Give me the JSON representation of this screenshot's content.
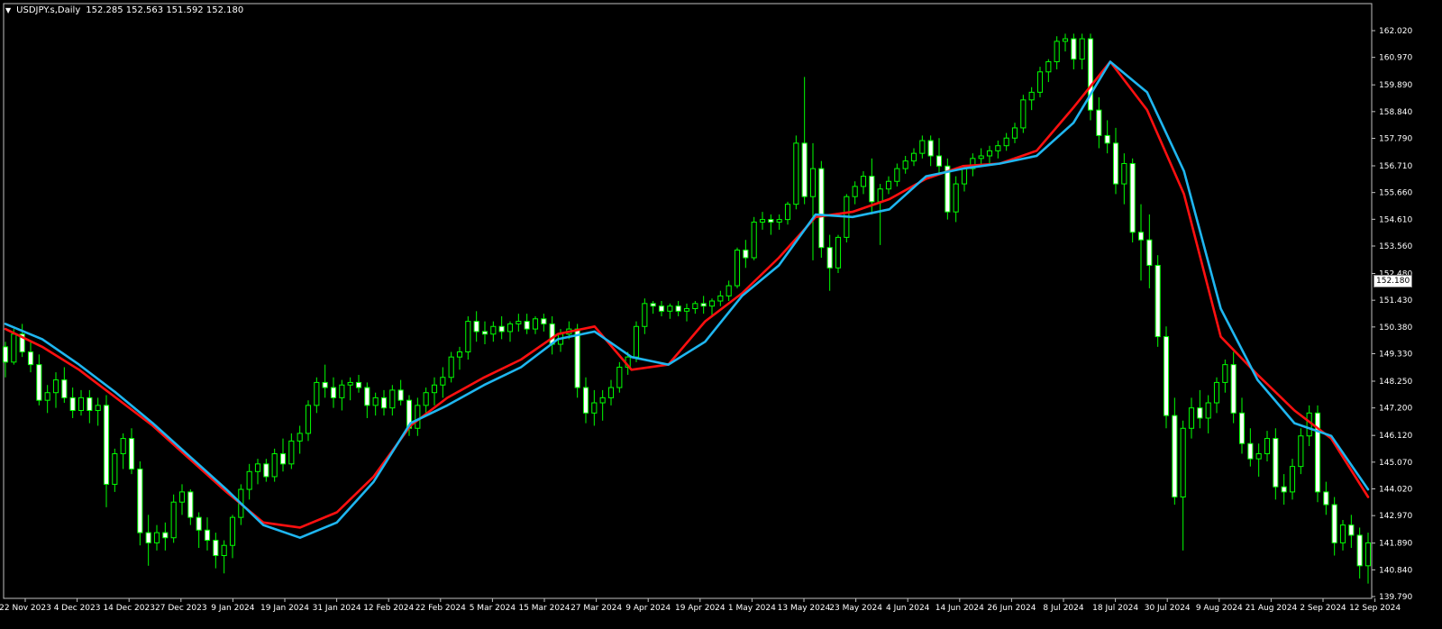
{
  "window": {
    "symbol_label": "USDJPY.s,Daily",
    "ohlc_label": "152.285 152.563 151.592 152.180",
    "current_price": "152.180"
  },
  "chart_data": {
    "type": "candlestick",
    "title": "USDJPY.s,Daily",
    "ylim": [
      139.79,
      162.4
    ],
    "y_ticks": [
      162.02,
      160.97,
      159.89,
      158.84,
      157.79,
      156.71,
      155.66,
      154.61,
      153.56,
      152.48,
      151.43,
      150.38,
      149.33,
      148.25,
      147.2,
      146.12,
      145.07,
      144.02,
      142.97,
      141.89,
      140.84,
      139.79
    ],
    "x_tick_labels": [
      "22 Nov 2023",
      "4 Dec 2023",
      "14 Dec 2023",
      "27 Dec 2023",
      "9 Jan 2024",
      "19 Jan 2024",
      "31 Jan 2024",
      "12 Feb 2024",
      "22 Feb 2024",
      "5 Mar 2024",
      "15 Mar 2024",
      "27 Mar 2024",
      "9 Apr 2024",
      "19 Apr 2024",
      "1 May 2024",
      "13 May 2024",
      "23 May 2024",
      "4 Jun 2024",
      "14 Jun 2024",
      "26 Jun 2024",
      "8 Jul 2024",
      "18 Jul 2024",
      "30 Jul 2024",
      "9 Aug 2024",
      "21 Aug 2024",
      "2 Sep 2024",
      "12 Sep 2024"
    ],
    "series": [
      {
        "name": "",
        "kind": "candles",
        "color": "#00ff00",
        "values": [
          [
            149.6,
            149.8,
            148.4,
            149.0
          ],
          [
            149.0,
            150.3,
            148.9,
            150.1
          ],
          [
            150.1,
            150.5,
            149.2,
            149.4
          ],
          [
            149.4,
            149.8,
            148.6,
            148.9
          ],
          [
            148.9,
            149.3,
            147.3,
            147.5
          ],
          [
            147.5,
            148.1,
            147.0,
            147.8
          ],
          [
            147.8,
            148.6,
            147.2,
            148.3
          ],
          [
            148.3,
            148.8,
            147.4,
            147.6
          ],
          [
            147.6,
            148.0,
            146.8,
            147.1
          ],
          [
            147.1,
            147.9,
            146.9,
            147.6
          ],
          [
            147.6,
            147.9,
            146.6,
            147.1
          ],
          [
            147.1,
            147.6,
            146.5,
            147.3
          ],
          [
            147.3,
            147.7,
            143.3,
            144.2
          ],
          [
            144.2,
            145.6,
            143.9,
            145.4
          ],
          [
            145.4,
            146.2,
            144.8,
            146.0
          ],
          [
            146.0,
            146.4,
            144.6,
            144.8
          ],
          [
            144.8,
            145.1,
            141.8,
            142.3
          ],
          [
            142.3,
            143.0,
            141.0,
            141.9
          ],
          [
            141.9,
            142.6,
            141.6,
            142.3
          ],
          [
            142.3,
            142.7,
            141.6,
            142.1
          ],
          [
            142.1,
            143.8,
            141.9,
            143.5
          ],
          [
            143.5,
            144.2,
            143.0,
            143.9
          ],
          [
            143.9,
            144.0,
            142.6,
            142.9
          ],
          [
            142.9,
            143.1,
            141.7,
            142.4
          ],
          [
            142.4,
            142.9,
            141.6,
            142.0
          ],
          [
            142.0,
            142.3,
            140.9,
            141.4
          ],
          [
            141.4,
            142.0,
            140.7,
            141.8
          ],
          [
            141.8,
            143.0,
            141.3,
            142.9
          ],
          [
            142.9,
            144.2,
            142.6,
            144.0
          ],
          [
            144.0,
            145.0,
            143.6,
            144.7
          ],
          [
            144.7,
            145.2,
            144.2,
            145.0
          ],
          [
            145.0,
            145.2,
            144.3,
            144.5
          ],
          [
            144.5,
            145.6,
            144.3,
            145.4
          ],
          [
            145.4,
            146.0,
            144.7,
            145.0
          ],
          [
            145.0,
            146.2,
            144.8,
            145.9
          ],
          [
            145.9,
            146.5,
            145.4,
            146.2
          ],
          [
            146.2,
            147.5,
            145.9,
            147.3
          ],
          [
            147.3,
            148.4,
            147.0,
            148.2
          ],
          [
            148.2,
            148.9,
            147.6,
            148.0
          ],
          [
            148.0,
            148.4,
            147.2,
            147.6
          ],
          [
            147.6,
            148.3,
            147.1,
            148.1
          ],
          [
            148.1,
            148.4,
            147.5,
            148.2
          ],
          [
            148.2,
            148.5,
            147.8,
            148.0
          ],
          [
            148.0,
            148.2,
            146.8,
            147.3
          ],
          [
            147.3,
            147.8,
            146.9,
            147.6
          ],
          [
            147.6,
            147.9,
            146.9,
            147.2
          ],
          [
            147.2,
            148.1,
            146.9,
            147.9
          ],
          [
            147.9,
            148.3,
            147.3,
            147.5
          ],
          [
            147.5,
            147.7,
            146.1,
            146.4
          ],
          [
            146.4,
            147.6,
            146.1,
            147.3
          ],
          [
            147.3,
            148.0,
            147.0,
            147.8
          ],
          [
            147.8,
            148.4,
            147.3,
            148.1
          ],
          [
            148.1,
            148.8,
            147.6,
            148.4
          ],
          [
            148.4,
            149.4,
            148.2,
            149.2
          ],
          [
            149.2,
            149.6,
            148.7,
            149.4
          ],
          [
            149.4,
            150.8,
            149.1,
            150.6
          ],
          [
            150.6,
            151.0,
            149.8,
            150.2
          ],
          [
            150.2,
            150.6,
            149.7,
            150.1
          ],
          [
            150.1,
            150.6,
            149.8,
            150.4
          ],
          [
            150.4,
            150.8,
            149.9,
            150.2
          ],
          [
            150.2,
            150.6,
            149.8,
            150.5
          ],
          [
            150.5,
            150.9,
            150.2,
            150.6
          ],
          [
            150.6,
            150.9,
            150.1,
            150.3
          ],
          [
            150.3,
            150.8,
            150.1,
            150.7
          ],
          [
            150.7,
            150.9,
            150.2,
            150.5
          ],
          [
            150.5,
            150.8,
            149.3,
            149.7
          ],
          [
            149.7,
            150.3,
            149.4,
            150.1
          ],
          [
            150.1,
            150.6,
            149.9,
            150.3
          ],
          [
            150.3,
            150.5,
            147.6,
            148.0
          ],
          [
            148.0,
            148.4,
            146.6,
            147.0
          ],
          [
            147.0,
            147.9,
            146.5,
            147.4
          ],
          [
            147.4,
            147.9,
            146.7,
            147.6
          ],
          [
            147.6,
            148.3,
            147.3,
            148.0
          ],
          [
            148.0,
            149.0,
            147.8,
            148.8
          ],
          [
            148.8,
            149.4,
            148.5,
            149.2
          ],
          [
            149.2,
            150.6,
            149.0,
            150.4
          ],
          [
            150.4,
            151.5,
            150.1,
            151.3
          ],
          [
            151.3,
            151.4,
            150.9,
            151.2
          ],
          [
            151.2,
            151.4,
            150.8,
            151.0
          ],
          [
            151.0,
            151.3,
            150.7,
            151.2
          ],
          [
            151.2,
            151.4,
            150.8,
            151.0
          ],
          [
            151.0,
            151.3,
            150.6,
            151.1
          ],
          [
            151.1,
            151.4,
            150.9,
            151.3
          ],
          [
            151.3,
            151.6,
            150.9,
            151.2
          ],
          [
            151.2,
            151.5,
            150.8,
            151.4
          ],
          [
            151.4,
            151.8,
            151.2,
            151.6
          ],
          [
            151.6,
            152.2,
            151.4,
            152.0
          ],
          [
            152.0,
            153.5,
            151.9,
            153.4
          ],
          [
            153.4,
            153.8,
            152.7,
            153.1
          ],
          [
            153.1,
            154.7,
            153.0,
            154.5
          ],
          [
            154.5,
            154.9,
            154.2,
            154.6
          ],
          [
            154.6,
            154.8,
            154.0,
            154.5
          ],
          [
            154.5,
            154.8,
            154.2,
            154.6
          ],
          [
            154.6,
            155.3,
            154.4,
            155.2
          ],
          [
            155.2,
            157.9,
            155.0,
            157.6
          ],
          [
            157.6,
            160.2,
            155.2,
            155.5
          ],
          [
            155.5,
            157.6,
            153.0,
            156.6
          ],
          [
            156.6,
            156.9,
            153.1,
            153.5
          ],
          [
            153.5,
            154.0,
            151.8,
            152.7
          ],
          [
            152.7,
            154.0,
            152.5,
            153.9
          ],
          [
            153.9,
            155.6,
            153.7,
            155.5
          ],
          [
            155.5,
            156.1,
            155.2,
            155.9
          ],
          [
            155.9,
            156.5,
            155.6,
            156.3
          ],
          [
            156.3,
            157.0,
            154.8,
            155.3
          ],
          [
            155.3,
            156.0,
            153.6,
            155.8
          ],
          [
            155.8,
            156.3,
            155.6,
            156.1
          ],
          [
            156.1,
            156.8,
            155.9,
            156.6
          ],
          [
            156.6,
            157.1,
            156.4,
            156.9
          ],
          [
            156.9,
            157.4,
            156.7,
            157.2
          ],
          [
            157.2,
            157.9,
            157.0,
            157.7
          ],
          [
            157.7,
            157.9,
            156.7,
            157.1
          ],
          [
            157.1,
            157.8,
            156.4,
            156.7
          ],
          [
            156.7,
            157.0,
            154.6,
            154.9
          ],
          [
            154.9,
            156.3,
            154.5,
            156.0
          ],
          [
            156.0,
            156.7,
            155.7,
            156.6
          ],
          [
            156.6,
            157.2,
            156.3,
            157.0
          ],
          [
            157.0,
            157.4,
            156.7,
            157.1
          ],
          [
            157.1,
            157.5,
            156.8,
            157.3
          ],
          [
            157.3,
            157.7,
            157.0,
            157.5
          ],
          [
            157.5,
            158.0,
            157.3,
            157.8
          ],
          [
            157.8,
            158.4,
            157.6,
            158.2
          ],
          [
            158.2,
            159.5,
            158.0,
            159.3
          ],
          [
            159.3,
            159.8,
            158.9,
            159.6
          ],
          [
            159.6,
            160.6,
            159.4,
            160.4
          ],
          [
            160.4,
            160.9,
            160.0,
            160.8
          ],
          [
            160.8,
            161.8,
            160.5,
            161.6
          ],
          [
            161.6,
            161.9,
            161.2,
            161.7
          ],
          [
            161.7,
            161.9,
            160.5,
            160.9
          ],
          [
            160.9,
            161.9,
            160.5,
            161.7
          ],
          [
            161.7,
            161.9,
            158.5,
            158.9
          ],
          [
            158.9,
            159.4,
            157.4,
            157.9
          ],
          [
            157.9,
            158.5,
            157.2,
            157.6
          ],
          [
            157.6,
            158.2,
            155.6,
            156.0
          ],
          [
            156.0,
            157.2,
            155.2,
            156.8
          ],
          [
            156.8,
            157.0,
            153.7,
            154.1
          ],
          [
            154.1,
            155.2,
            152.2,
            153.8
          ],
          [
            153.8,
            154.8,
            151.9,
            152.8
          ],
          [
            152.8,
            153.2,
            149.6,
            150.0
          ],
          [
            150.0,
            150.4,
            146.4,
            146.9
          ],
          [
            146.9,
            147.6,
            143.4,
            143.7
          ],
          [
            143.7,
            146.7,
            141.6,
            146.4
          ],
          [
            146.4,
            147.6,
            146.0,
            147.2
          ],
          [
            147.2,
            147.9,
            146.4,
            146.8
          ],
          [
            146.8,
            147.7,
            146.2,
            147.4
          ],
          [
            147.4,
            148.4,
            147.0,
            148.2
          ],
          [
            148.2,
            149.1,
            147.8,
            148.9
          ],
          [
            148.9,
            149.4,
            146.6,
            147.0
          ],
          [
            147.0,
            147.6,
            145.4,
            145.8
          ],
          [
            145.8,
            146.4,
            144.9,
            145.2
          ],
          [
            145.2,
            145.8,
            144.5,
            145.4
          ],
          [
            145.4,
            146.3,
            145.1,
            146.0
          ],
          [
            146.0,
            146.4,
            143.6,
            144.1
          ],
          [
            144.1,
            144.6,
            143.4,
            143.9
          ],
          [
            143.9,
            145.2,
            143.6,
            144.9
          ],
          [
            144.9,
            146.4,
            144.6,
            146.1
          ],
          [
            146.1,
            147.3,
            145.7,
            147.0
          ],
          [
            147.0,
            147.3,
            143.5,
            143.9
          ],
          [
            143.9,
            144.3,
            143.0,
            143.4
          ],
          [
            143.4,
            143.7,
            141.4,
            141.9
          ],
          [
            141.9,
            142.8,
            141.6,
            142.6
          ],
          [
            142.6,
            143.0,
            141.7,
            142.2
          ],
          [
            142.2,
            142.5,
            140.5,
            141.0
          ],
          [
            141.0,
            142.3,
            140.3,
            141.9
          ]
        ]
      },
      {
        "name": "",
        "kind": "line",
        "color": "#ff1010",
        "values": [
          150.3,
          149.6,
          148.7,
          147.6,
          146.5,
          145.2,
          143.9,
          142.7,
          142.5,
          143.1,
          144.5,
          146.5,
          147.6,
          148.4,
          149.1,
          150.1,
          150.4,
          148.7,
          148.9,
          150.6,
          151.7,
          153.1,
          154.7,
          154.9,
          155.4,
          156.2,
          156.7,
          156.8,
          157.3,
          159.0,
          160.8,
          158.9,
          155.6,
          150.0,
          148.5,
          147.1,
          146.0,
          143.7
        ]
      },
      {
        "name": "",
        "kind": "line",
        "color": "#1fb6f0",
        "values": [
          150.5,
          149.9,
          148.9,
          147.8,
          146.6,
          145.3,
          144.0,
          142.6,
          142.1,
          142.7,
          144.3,
          146.6,
          147.3,
          148.1,
          148.8,
          149.9,
          150.2,
          149.2,
          148.9,
          149.8,
          151.6,
          152.8,
          154.8,
          154.7,
          155.0,
          156.3,
          156.6,
          156.8,
          157.1,
          158.4,
          160.8,
          159.6,
          156.5,
          151.1,
          148.3,
          146.6,
          146.1,
          144.0
        ]
      }
    ]
  }
}
